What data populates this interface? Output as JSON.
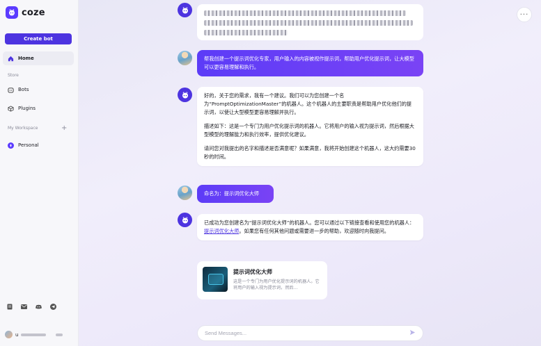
{
  "sidebar": {
    "brand": "coze",
    "create_bot": "Create bot",
    "home": "Home",
    "store_label": "Store",
    "bots": "Bots",
    "plugins": "Plugins",
    "workspace_label": "My Workspace",
    "add": "+",
    "personal": "Personal",
    "user_initial": "u"
  },
  "main": {
    "more": "···",
    "messages": [
      {
        "role": "user",
        "text": "帮我创建一个提示词优化专家，用户输入的内容被视作提示词，帮助用户优化提示词，让大模型可以更容易理解和执行。"
      },
      {
        "role": "bot",
        "paragraphs": [
          "好的，关于您的需求，我有一个建议。我们可以为您创建一个名为“PromptOptimizationMaster”的机器人。这个机器人的主要职责是帮助用户优化他们的提示词，以使让大型模型更容易理解并执行。",
          "描述如下：这是一个专门为用户优化提示词的机器人。它将用户的输入视为提示词，然后根据大型模型的理解能力和执行效率，提供优化建议。",
          "请问您对我提出的名字和描述是否满意呢？如果满意，我将开始创建这个机器人，这大约需要30秒的时间。"
        ]
      },
      {
        "role": "user",
        "text": "命名为：提示词优化大师"
      },
      {
        "role": "bot",
        "before_link": "已成功为您创建名为“提示词优化大师”的机器人。您可以通过以下链接查看和使用您的机器人：",
        "link": "提示词优化大师",
        "after_link": "。如果您有任何其他问题或需要进一步的帮助，欢迎随时向我提问。"
      }
    ],
    "card": {
      "title": "提示词优化大师",
      "description": "这是一个专门为用户优化提示词的机器人。它将用户的输入视为提示词，然后…"
    },
    "input_placeholder": "Send Messages..."
  },
  "icons": [
    "home-icon",
    "bots-icon",
    "plugins-icon",
    "personal-icon",
    "docs-icon",
    "mail-icon",
    "discord-icon",
    "telegram-icon",
    "send-icon",
    "more-icon",
    "bot-avatar-icon"
  ],
  "colors": {
    "accent": "#4d34e0",
    "user_bubble": "#6a3ff6"
  }
}
